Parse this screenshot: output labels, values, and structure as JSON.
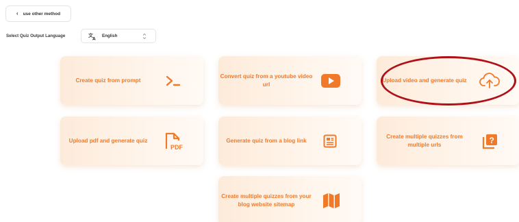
{
  "back_button": {
    "label": "use other method",
    "icon": "chevron-left-icon"
  },
  "language": {
    "label": "Select Quiz Output Language",
    "selected": "English",
    "icon": "translate-icon"
  },
  "cards": [
    {
      "title": "Create quiz from prompt",
      "icon": "terminal-prompt-icon"
    },
    {
      "title": "Convert quiz from a youtube video url",
      "icon": "youtube-play-icon"
    },
    {
      "title": "Upload video and generate quiz",
      "icon": "cloud-upload-icon"
    },
    {
      "title": "Upload pdf and generate quiz",
      "icon": "pdf-file-icon"
    },
    {
      "title": "Generate quiz from a blog link",
      "icon": "article-icon"
    },
    {
      "title": "Create multiple quizzes from multiple urls",
      "icon": "question-stack-icon"
    },
    {
      "title": "Create multiple quizzes from your blog website sitemap",
      "icon": "map-icon"
    }
  ],
  "pdf_icon_text": "PDF",
  "question_icon_text": "?",
  "colors": {
    "accent": "#f07a2a",
    "card_bg_start": "#fdebda",
    "highlight_ring": "#b01018"
  }
}
